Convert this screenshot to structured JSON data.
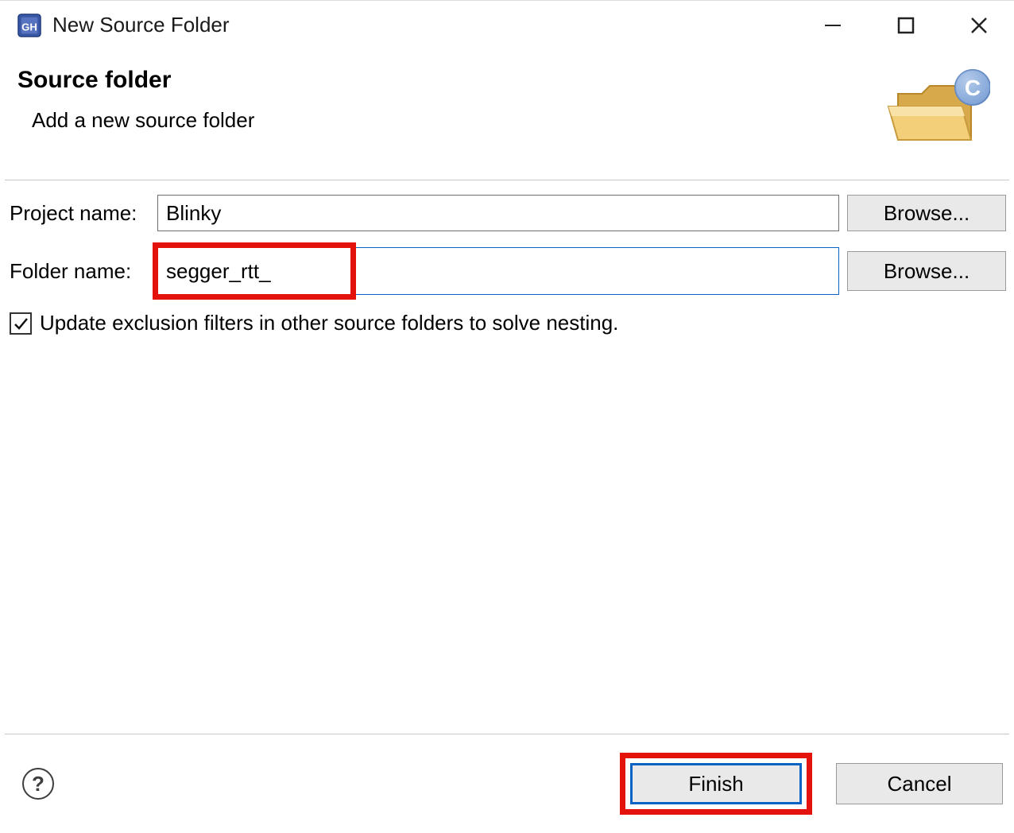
{
  "titlebar": {
    "title": "New Source Folder"
  },
  "header": {
    "heading": "Source folder",
    "subheading": "Add a new source folder"
  },
  "form": {
    "project_label": "Project name:",
    "project_value": "Blinky",
    "project_browse": "Browse...",
    "folder_label": "Folder name:",
    "folder_value": "segger_rtt_",
    "folder_browse": "Browse...",
    "checkbox_checked": true,
    "checkbox_label": "Update exclusion filters in other source folders to solve nesting."
  },
  "footer": {
    "finish": "Finish",
    "cancel": "Cancel"
  }
}
